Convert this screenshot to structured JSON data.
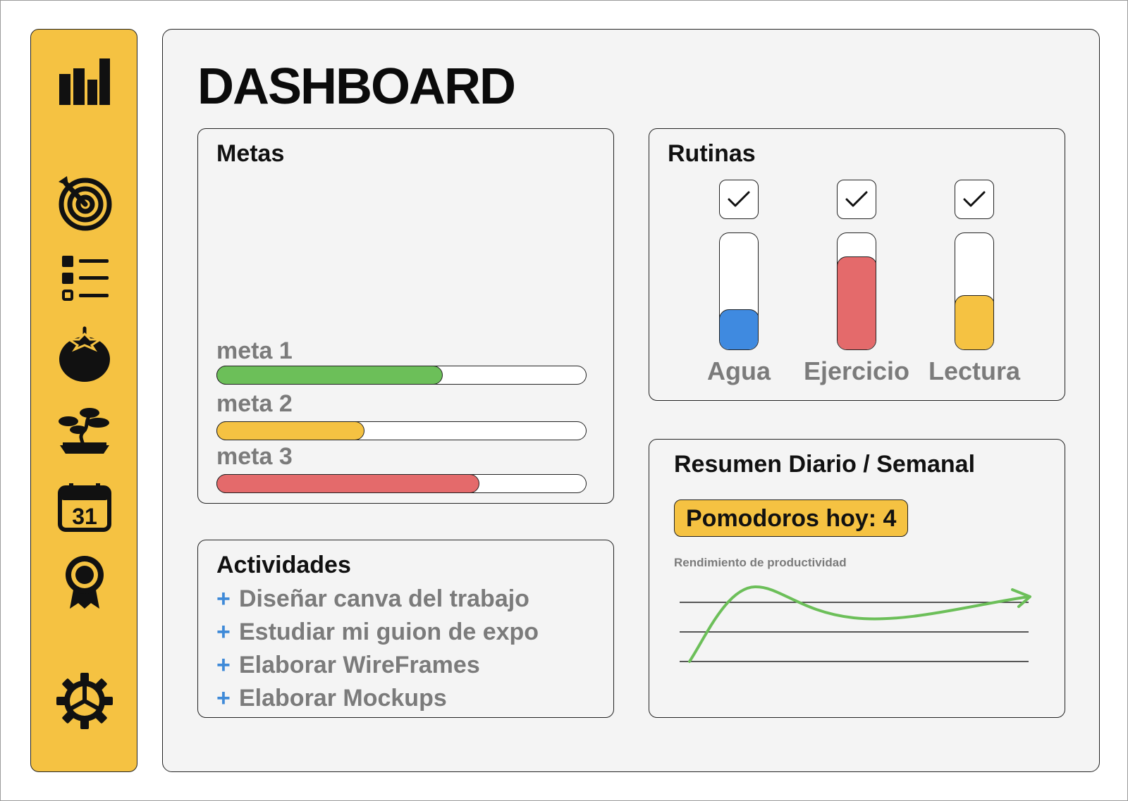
{
  "header": {
    "title": "DASHBOARD"
  },
  "sidebar": {
    "color": "#F5C242",
    "items": [
      {
        "icon": "bar-chart-icon"
      },
      {
        "icon": "target-icon"
      },
      {
        "icon": "task-list-icon"
      },
      {
        "icon": "tomato-icon"
      },
      {
        "icon": "bonsai-icon"
      },
      {
        "icon": "calendar-icon",
        "text": "31"
      },
      {
        "icon": "award-icon"
      },
      {
        "icon": "gear-icon"
      }
    ]
  },
  "metas": {
    "title": "Metas",
    "items": [
      {
        "label": "meta 1",
        "progress": 0.61,
        "color": "#6CBF59"
      },
      {
        "label": "meta 2",
        "progress": 0.4,
        "color": "#F5C242"
      },
      {
        "label": "meta 3",
        "progress": 0.71,
        "color": "#E46A6B"
      }
    ]
  },
  "actividades": {
    "title": "Actividades",
    "items": [
      {
        "plus": "+",
        "label": "Diseñar canva del trabajo"
      },
      {
        "plus": "+",
        "label": "Estudiar mi guion de expo"
      },
      {
        "plus": "+",
        "label": "Elaborar WireFrames"
      },
      {
        "plus": "+",
        "label": "Elaborar Mockups"
      }
    ]
  },
  "rutinas": {
    "title": "Rutinas",
    "items": [
      {
        "label": "Agua",
        "level": 0.35,
        "color": "#3F8AE0",
        "checked": true
      },
      {
        "label": "Ejercicio",
        "level": 0.8,
        "color": "#E46A6B",
        "checked": true
      },
      {
        "label": "Lectura",
        "level": 0.47,
        "color": "#F5C242",
        "checked": true
      }
    ]
  },
  "resumen": {
    "title": "Resumen Diario / Semanal",
    "badge": "Pomodoros hoy: 4",
    "chart_caption": "Rendimiento de productividad",
    "line_color": "#6CBF59"
  }
}
